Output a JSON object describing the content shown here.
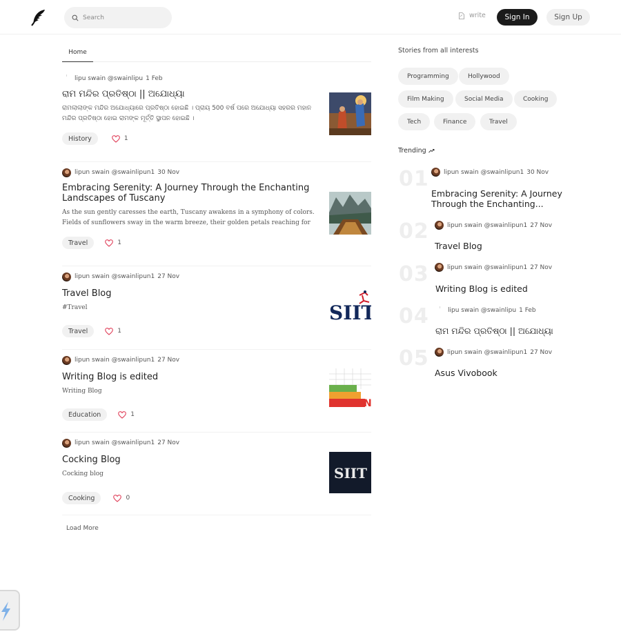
{
  "header": {
    "search_placeholder": "Search",
    "write_label": "write",
    "signin_label": "Sign In",
    "signup_label": "Sign Up"
  },
  "feed": {
    "tab_home": "Home",
    "load_more": "Load More",
    "posts": [
      {
        "author": "lipu swain @swainlipu",
        "date": "1 Feb",
        "title": "ରାମ ମନ୍ଦିର ପ୍ରତିଷ୍ଠା || ଅଯୋଧ୍ୟା",
        "excerpt": "ରାମଲାଲାଙ୍କ ମନ୍ଦିର ଅଯୋଧ୍ୟାରେ ପ୍ରତିଷ୍ଠା ହୋଇଛି । ପ୍ରାୟ 500 ବର୍ଷ ପରେ ଅଯୋଧ୍ୟା ସହରର ମହାନ ମନ୍ଦିର ପ୍ରତିଷ୍ଠା ହୋଇ ରାମଙ୍କ ମୂର୍ତ୍ତି ସ୍ଥାପନ ହୋଇଛି ।",
        "tag": "History",
        "likes": "1"
      },
      {
        "author": "lipun swain @swainlipun1",
        "date": "30 Nov",
        "title": "Embracing Serenity: A Journey Through the Enchanting Landscapes of Tuscany",
        "excerpt": "As the sun gently caresses the earth, Tuscany awakens in a symphony of colors. Fields of sunflowers sway in the warm breeze, their golden petals reaching for the...",
        "tag": "Travel",
        "likes": "1"
      },
      {
        "author": "lipun swain @swainlipun1",
        "date": "27 Nov",
        "title": "Travel Blog",
        "excerpt": "#Travel",
        "tag": "Travel",
        "likes": "1"
      },
      {
        "author": "lipun swain @swainlipun1",
        "date": "27 Nov",
        "title": "Writing Blog is edited",
        "excerpt": "Writing Blog",
        "tag": "Education",
        "likes": "1"
      },
      {
        "author": "lipun swain @swainlipun1",
        "date": "27 Nov",
        "title": "Cocking Blog",
        "excerpt": "Cocking blog",
        "tag": "Cooking",
        "likes": "0"
      }
    ]
  },
  "thumbs": {
    "siit_text": "SIIT",
    "siit_dark_text": "SIIT"
  },
  "sidebar": {
    "interests_title": "Stories from all interests",
    "topics": [
      "Programming",
      "Hollywood",
      "Film Making",
      "Social Media",
      "Cooking",
      "Tech",
      "Finance",
      "Travel"
    ],
    "trending_title": "Trending",
    "trending": [
      {
        "num": "01",
        "author": "lipun swain @swainlipun1",
        "date": "30 Nov",
        "title": "Embracing Serenity: A Journey Through the Enchanting..."
      },
      {
        "num": "02",
        "author": "lipun swain @swainlipun1",
        "date": "27 Nov",
        "title": "Travel Blog"
      },
      {
        "num": "03",
        "author": "lipun swain @swainlipun1",
        "date": "27 Nov",
        "title": "Writing Blog is edited"
      },
      {
        "num": "04",
        "author": "lipu swain @swainlipu",
        "date": "1 Feb",
        "title": "ରାମ ମନ୍ଦିର ପ୍ରତିଷ୍ଠା || ଅଯୋଧ୍ୟା"
      },
      {
        "num": "05",
        "author": "lipun swain @swainlipun1",
        "date": "27 Nov",
        "title": "Asus Vivobook"
      }
    ]
  }
}
